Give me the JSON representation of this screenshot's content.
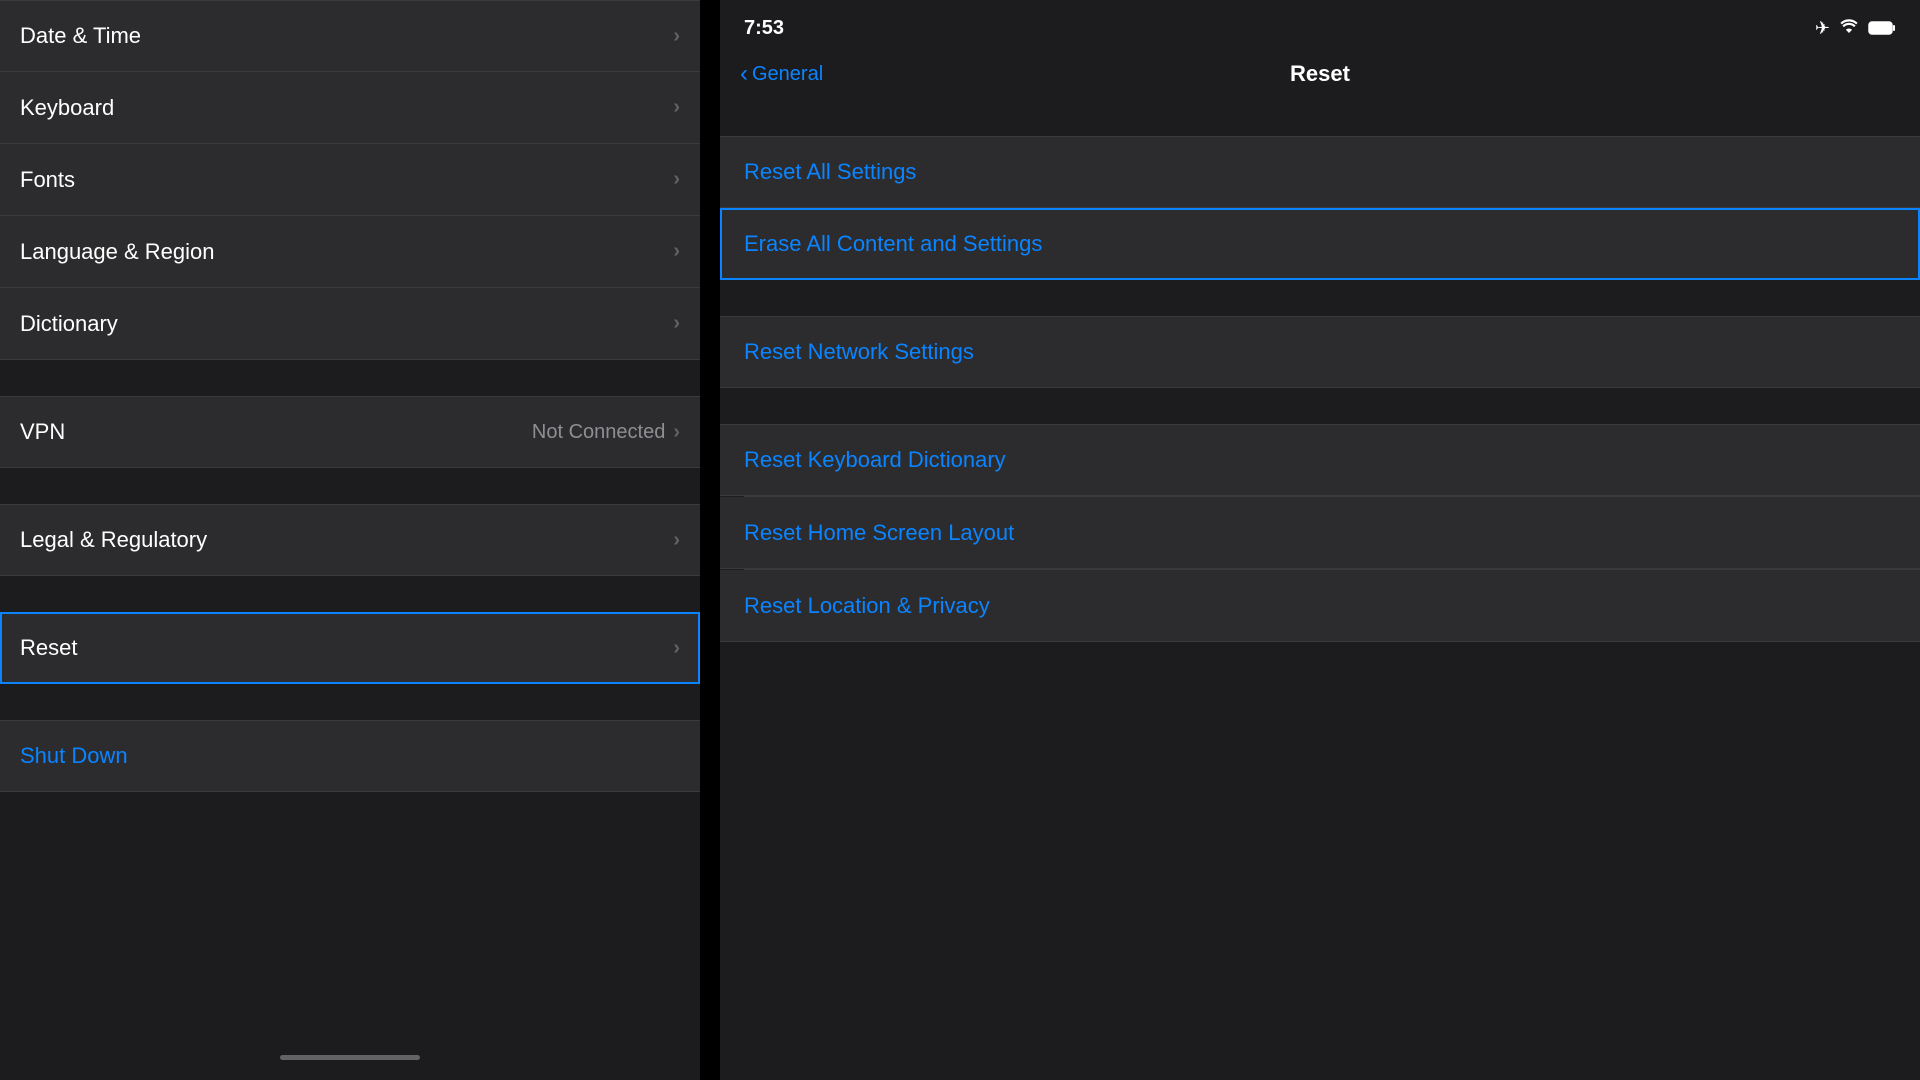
{
  "left_panel": {
    "items_group1": [
      {
        "id": "date-time",
        "label": "Date & Time",
        "value": "",
        "selected": false
      },
      {
        "id": "keyboard",
        "label": "Keyboard",
        "value": "",
        "selected": false
      },
      {
        "id": "fonts",
        "label": "Fonts",
        "value": "",
        "selected": false
      },
      {
        "id": "language-region",
        "label": "Language & Region",
        "value": "",
        "selected": false
      },
      {
        "id": "dictionary",
        "label": "Dictionary",
        "value": "",
        "selected": false
      }
    ],
    "items_group2": [
      {
        "id": "vpn",
        "label": "VPN",
        "value": "Not Connected",
        "selected": false
      }
    ],
    "items_group3": [
      {
        "id": "legal",
        "label": "Legal & Regulatory",
        "value": "",
        "selected": false
      }
    ],
    "items_group4": [
      {
        "id": "reset",
        "label": "Reset",
        "value": "",
        "selected": true
      }
    ],
    "shutdown_label": "Shut Down"
  },
  "right_panel": {
    "status_bar": {
      "time": "7:53"
    },
    "nav": {
      "back_label": "General",
      "title": "Reset"
    },
    "reset_items_group1": [
      {
        "id": "reset-all-settings",
        "label": "Reset All Settings",
        "selected": false
      }
    ],
    "reset_items_group2": [
      {
        "id": "erase-all",
        "label": "Erase All Content and Settings",
        "selected": true
      }
    ],
    "reset_items_group3": [
      {
        "id": "reset-network",
        "label": "Reset Network Settings",
        "selected": false
      }
    ],
    "reset_items_group4": [
      {
        "id": "reset-keyboard",
        "label": "Reset Keyboard Dictionary",
        "selected": false
      },
      {
        "id": "reset-home-screen",
        "label": "Reset Home Screen Layout",
        "selected": false
      },
      {
        "id": "reset-location",
        "label": "Reset Location & Privacy",
        "selected": false
      }
    ]
  },
  "chevron": "›",
  "back_chevron": "‹"
}
